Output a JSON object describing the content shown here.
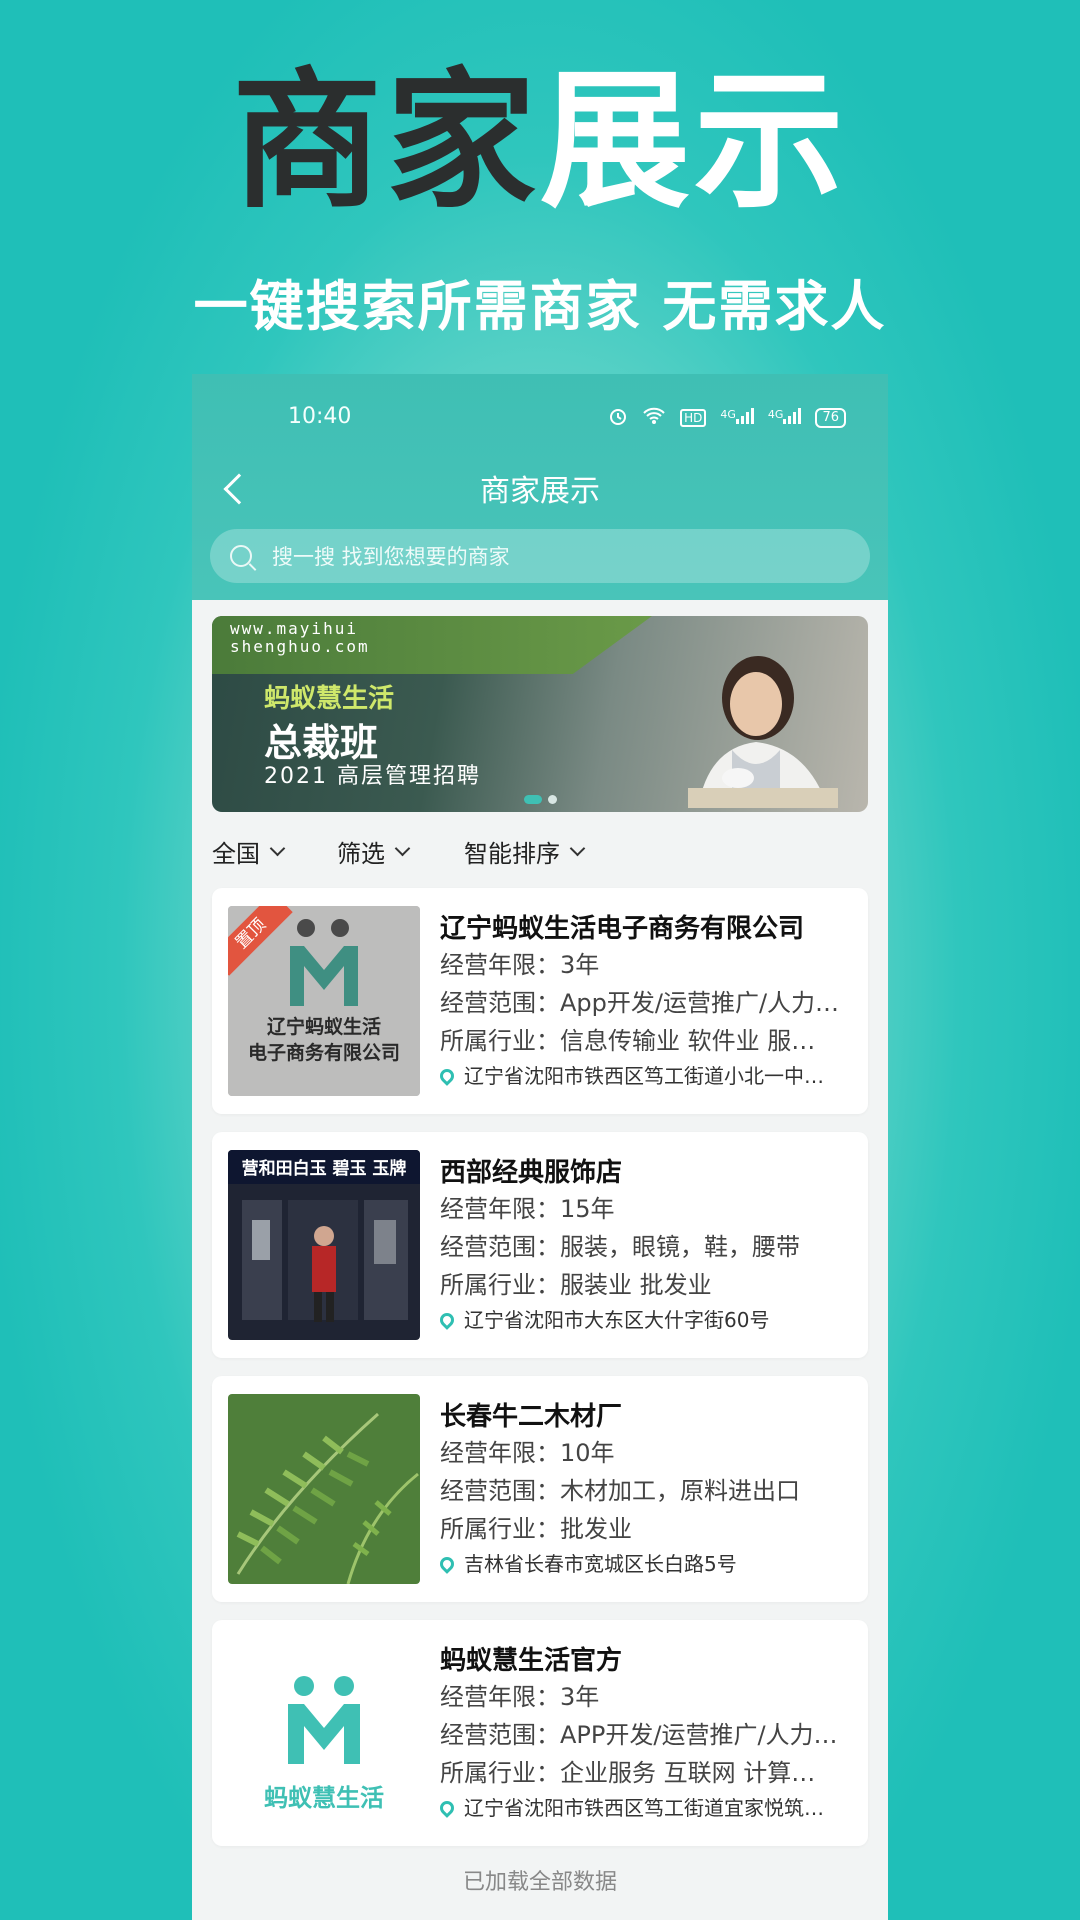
{
  "promo": {
    "title_dark": "商家",
    "title_light": "展示",
    "subtitle": "一键搜索所需商家 无需求人"
  },
  "status_bar": {
    "time": "10:40",
    "network_label_1": "4G",
    "network_label_2": "4G",
    "hd_label": "HD",
    "battery": "76"
  },
  "nav": {
    "title": "商家展示"
  },
  "search": {
    "placeholder": "搜一搜 找到您想要的商家"
  },
  "banner": {
    "url_line1": "www.mayihui",
    "url_line2": "shenghuo.com",
    "brand": "蚂蚁慧生活",
    "headline": "总裁班",
    "tagline": "2021 高层管理招聘"
  },
  "filters": [
    {
      "label": "全国"
    },
    {
      "label": "筛选"
    },
    {
      "label": "智能排序"
    }
  ],
  "merchants": [
    {
      "name": "辽宁蚂蚁生活电子商务有限公司",
      "years": "经营年限：3年",
      "scope": "经营范围：App开发/运营推广/人力…",
      "industry": "所属行业：信息传输业  软件业  服…",
      "address": "辽宁省沈阳市铁西区笃工街道小北一中…",
      "badge": "置顶",
      "thumb_text_1": "辽宁蚂蚁生活",
      "thumb_text_2": "电子商务有限公司"
    },
    {
      "name": "西部经典服饰店",
      "years": "经营年限：15年",
      "scope": "经营范围：服装，眼镜，鞋，腰带",
      "industry": "所属行业：服装业  批发业",
      "address": "辽宁省沈阳市大东区大什字街60号",
      "thumb_text_1": "营和田白玉 碧玉 玉牌"
    },
    {
      "name": "长春牛二木材厂",
      "years": "经营年限：10年",
      "scope": "经营范围：木材加工，原料进出口",
      "industry": "所属行业：批发业",
      "address": "吉林省长春市宽城区长白路5号"
    },
    {
      "name": "蚂蚁慧生活官方",
      "years": "经营年限：3年",
      "scope": "经营范围：APP开发/运营推广/人力…",
      "industry": "所属行业：企业服务  互联网  计算…",
      "address": "辽宁省沈阳市铁西区笃工街道宜家悦筑…",
      "thumb_text_1": "蚂蚁慧生活"
    }
  ],
  "footer": {
    "loaded_text": "已加载全部数据"
  },
  "colors": {
    "accent": "#3fbfb4",
    "badge": "#e2553f"
  }
}
